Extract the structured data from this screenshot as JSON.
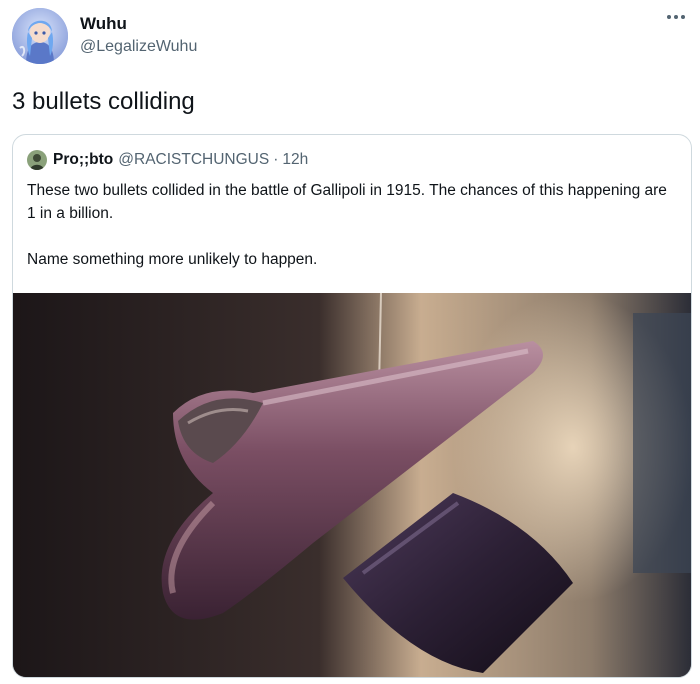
{
  "tweet": {
    "author": {
      "name": "Wuhu",
      "handle": "@LegalizeWuhu",
      "avatar_icon": "anime-character-avatar"
    },
    "more_icon": "more-horizontal-icon",
    "text": "3 bullets colliding"
  },
  "quote": {
    "author": {
      "name": "Pro;;bto",
      "handle": "@RACISTCHUNGUS",
      "avatar_icon": "user-avatar"
    },
    "separator": "·",
    "time": "12h",
    "paragraphs": [
      "These two bullets collided in the battle of Gallipoli in 1915. The chances of this happening are 1 in a billion.",
      "Name something more unlikely to happen."
    ],
    "media_description_icon": "collided-bullets-photo"
  },
  "colors": {
    "text_primary": "#0f1419",
    "text_secondary": "#536471",
    "border": "#cfd9de"
  }
}
